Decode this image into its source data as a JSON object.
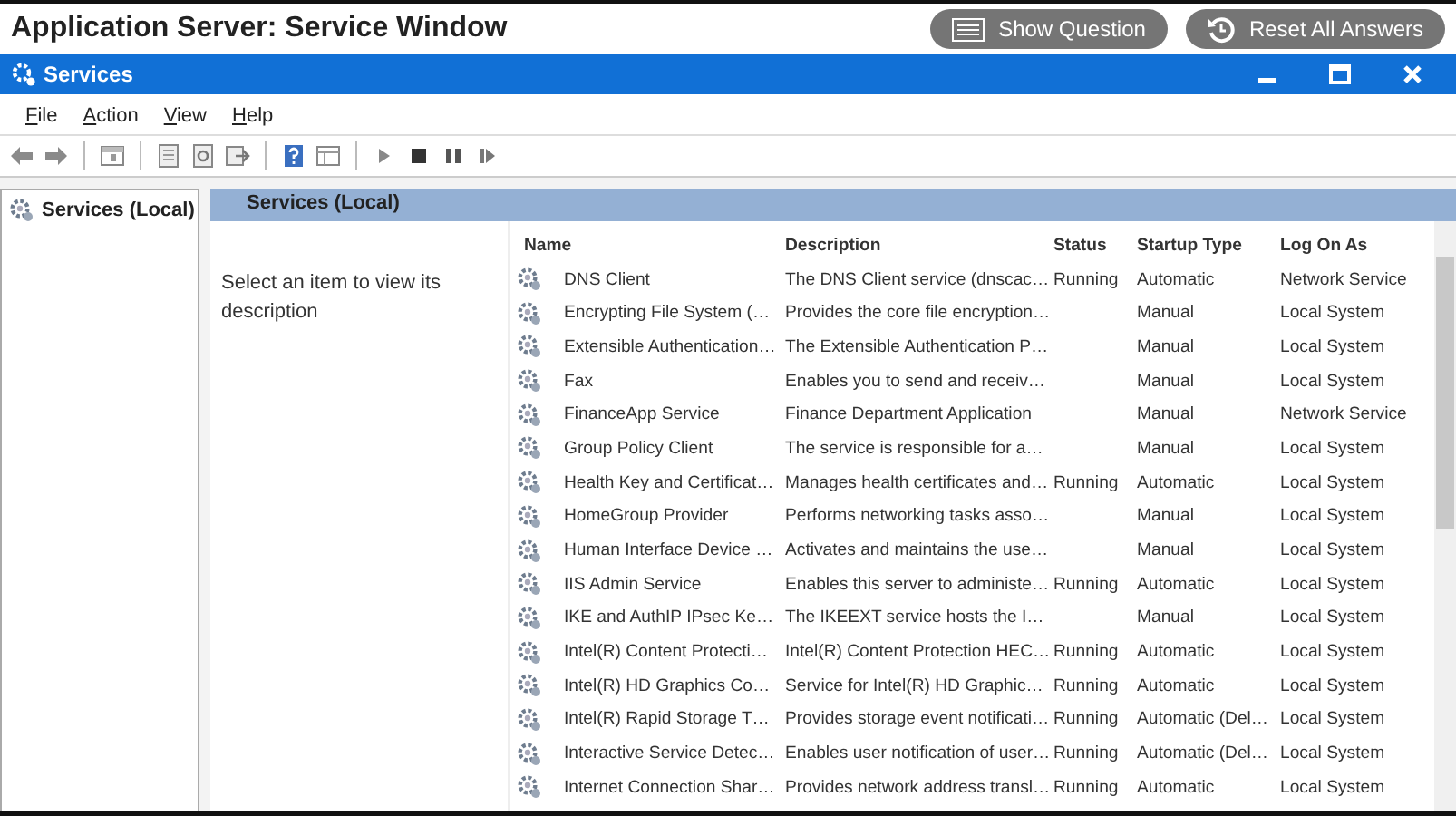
{
  "page": {
    "title": "Application Server: Service Window"
  },
  "header_buttons": [
    {
      "label": "Show Question",
      "kind": "question"
    },
    {
      "label": "Reset All Answers",
      "kind": "reset"
    }
  ],
  "window": {
    "title": "Services"
  },
  "menu": [
    "File",
    "Action",
    "View",
    "Help"
  ],
  "tree": {
    "items": [
      {
        "label": "Services (Local)"
      }
    ]
  },
  "panel": {
    "tab": "Services (Local)",
    "hint": "Select an item to view its description"
  },
  "table": {
    "columns": [
      "Name",
      "Description",
      "Status",
      "Startup Type",
      "Log On As"
    ],
    "rows": [
      [
        "DNS Client",
        "The DNS Client service (dnscac…",
        "Running",
        "Automatic",
        "Network Service"
      ],
      [
        "Encrypting File System (…",
        "Provides the core file encryption…",
        "",
        "Manual",
        "Local System"
      ],
      [
        "Extensible Authentication…",
        "The Extensible Authentication P…",
        "",
        "Manual",
        "Local System"
      ],
      [
        "Fax",
        "Enables you to send and receiv…",
        "",
        "Manual",
        "Local System"
      ],
      [
        "FinanceApp Service",
        "Finance Department Application",
        "",
        "Manual",
        "Network Service"
      ],
      [
        "Group Policy Client",
        "The service is responsible for a…",
        "",
        "Manual",
        "Local System"
      ],
      [
        "Health Key and Certificat…",
        "Manages health certificates and…",
        "Running",
        "Automatic",
        "Local System"
      ],
      [
        "HomeGroup Provider",
        "Performs networking tasks asso…",
        "",
        "Manual",
        "Local System"
      ],
      [
        "Human Interface Device …",
        "Activates and maintains the use…",
        "",
        "Manual",
        "Local System"
      ],
      [
        "IIS Admin Service",
        "Enables this server to administe…",
        "Running",
        "Automatic",
        "Local System"
      ],
      [
        "IKE and AuthIP IPsec Ke…",
        "The IKEEXT service hosts the I…",
        "",
        "Manual",
        "Local System"
      ],
      [
        "Intel(R) Content Protecti…",
        "Intel(R) Content Protection HEC…",
        "Running",
        "Automatic",
        "Local System"
      ],
      [
        "Intel(R) HD Graphics Co…",
        "Service for Intel(R) HD Graphic…",
        "Running",
        "Automatic",
        "Local System"
      ],
      [
        "Intel(R) Rapid Storage T…",
        "Provides storage event notificati…",
        "Running",
        "Automatic (Del…",
        "Local System"
      ],
      [
        "Interactive Service Detec…",
        "Enables user notification of user…",
        "Running",
        "Automatic (Del…",
        "Local System"
      ],
      [
        "Internet Connection Shar…",
        "Provides network address transl…",
        "Running",
        "Automatic",
        "Local System"
      ]
    ]
  }
}
